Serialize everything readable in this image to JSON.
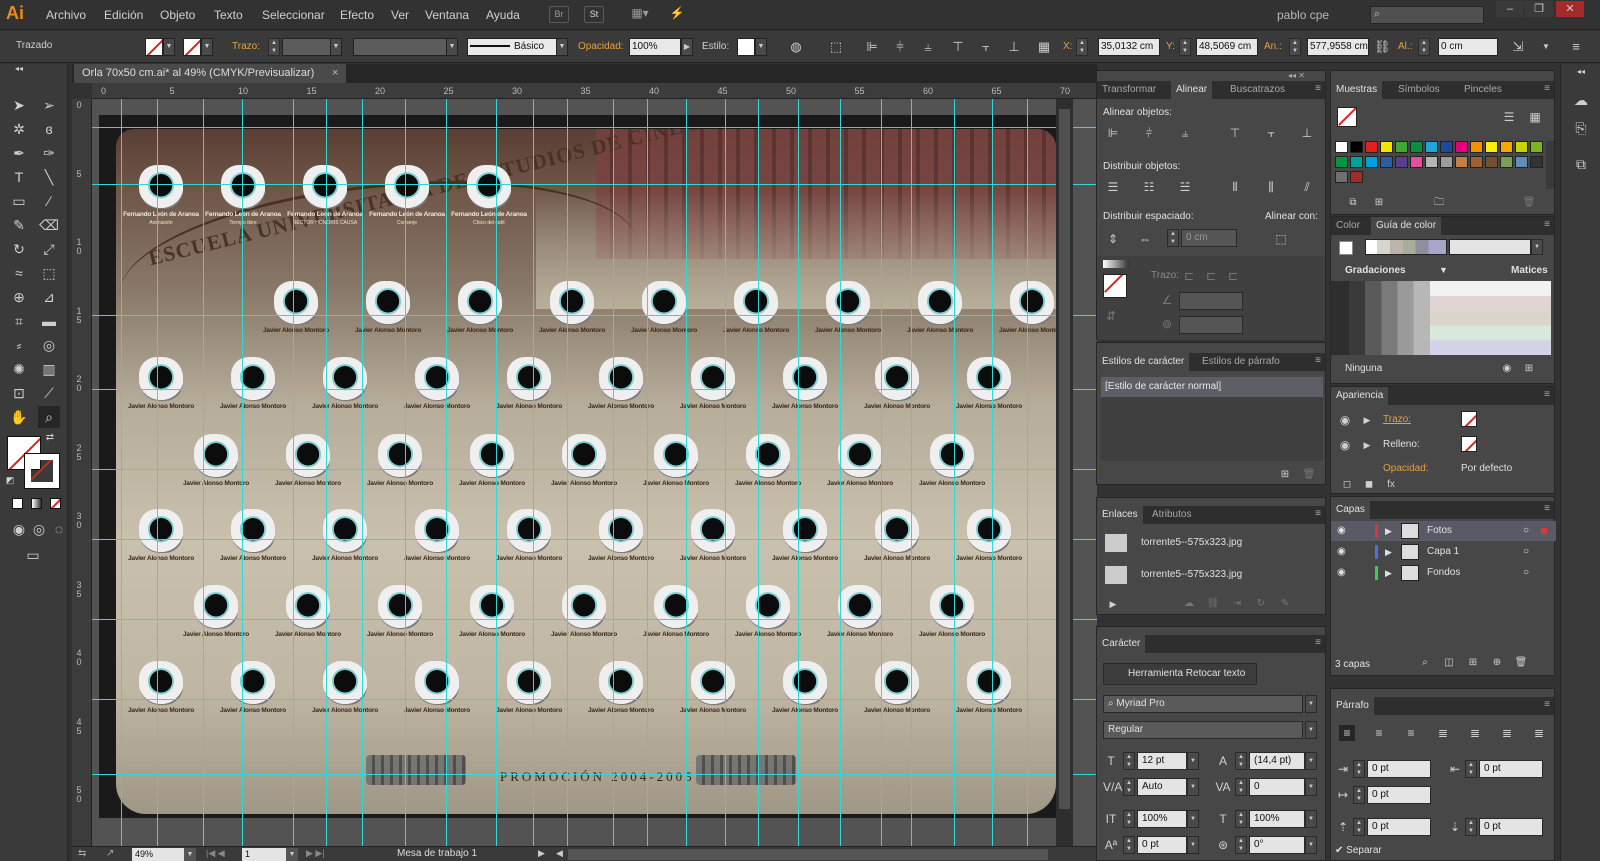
{
  "app": {
    "logo": "Ai",
    "menus": [
      "Archivo",
      "Edición",
      "Objeto",
      "Texto",
      "Seleccionar",
      "Efecto",
      "Ver",
      "Ventana",
      "Ayuda"
    ],
    "bridge_buttons": [
      "Br",
      "St"
    ],
    "user": "pablo cpe",
    "search_placeholder": ""
  },
  "control_bar": {
    "selection": "Trazado",
    "stroke_label": "Trazo:",
    "brush_label": "Básico",
    "opacity_label": "Opacidad:",
    "opacity_value": "100%",
    "style_label": "Estilo:",
    "x_label": "X:",
    "x_value": "35,0132 cm",
    "y_label": "Y:",
    "y_value": "48,5069 cm",
    "w_label": "An.:",
    "w_value": "577,9558 cm",
    "h_label": "Al.:",
    "h_value": "0 cm"
  },
  "document": {
    "tab_title": "Orla 70x50 cm.ai* al 49% (CMYK/Previsualizar)",
    "close": "×",
    "ruler_top": [
      "0",
      "5",
      "10",
      "15",
      "20",
      "25",
      "30",
      "35",
      "40",
      "45",
      "50",
      "55",
      "60",
      "65",
      "70"
    ],
    "ruler_left": [
      "0",
      "5",
      "1 0",
      "1 5",
      "2 0",
      "2 5",
      "3 0",
      "3 5",
      "4 0",
      "4 5",
      "5 0"
    ],
    "school_title": "ESCUELA UNIVERSITARIA DE ESTUDIOS DE CINE DE VALLADOLID",
    "teachers": [
      {
        "name": "Fernando León de Aranoa",
        "role": "Animación"
      },
      {
        "name": "Fernando León de Aranoa",
        "role": "Tiempo libre"
      },
      {
        "name": "Fernando León de Aranoa",
        "role": "RECTOR HONORIS CAUSA"
      },
      {
        "name": "Fernando León de Aranoa",
        "role": "Conserje"
      },
      {
        "name": "Fernando León de Aranoa",
        "role": "Chico del café"
      }
    ],
    "student_name": "Javier Alonso Montoro",
    "promotion": "PROMOCIÓN 2004-2005"
  },
  "status_bar": {
    "zoom": "49%",
    "page": "1",
    "artboard": "Mesa de trabajo 1"
  },
  "align_panel": {
    "tabs": [
      "Transformar",
      "Alinear",
      "Buscatrazos"
    ],
    "active": "Alinear",
    "align_objects": "Alinear objetos:",
    "distribute_objects": "Distribuir objetos:",
    "distribute_spacing": "Distribuir espaciado:",
    "align_to": "Alinear con:",
    "spacing_value": "0 cm",
    "stroke_label": "Trazo:"
  },
  "char_styles_panel": {
    "tabs": [
      "Estilos de carácter",
      "Estilos de párrafo"
    ],
    "items": [
      "[Estilo de carácter normal]"
    ]
  },
  "links_panel": {
    "tabs": [
      "Enlaces",
      "Atributos"
    ],
    "items": [
      "torrente5--575x323.jpg",
      "torrente5--575x323.jpg"
    ]
  },
  "character_panel": {
    "title": "Carácter",
    "touch_tool": "Herramienta Retocar texto",
    "font": "Myriad Pro",
    "style": "Regular",
    "size": "12 pt",
    "leading": "(14,4 pt)",
    "kerning": "Auto",
    "tracking": "0",
    "vscale": "100%",
    "hscale": "100%",
    "baseline": "0 pt",
    "rotation": "0°"
  },
  "swatches_panel": {
    "tabs": [
      "Muestras",
      "Símbolos",
      "Pinceles"
    ],
    "colors": [
      "#ffffff",
      "#000000",
      "#e3201b",
      "#f4e500",
      "#41a833",
      "#0a8f3c",
      "#1ea6d8",
      "#1d4b9b",
      "#e6007e",
      "#f39200",
      "#fcea10",
      "#f7a600",
      "#c8d400",
      "#7ab51d",
      "#00963f",
      "#00a19a",
      "#009fe3",
      "#2b5ca6",
      "#5b3e8d",
      "#e84e9a",
      "#b5b5b5",
      "#9d9d9c",
      "#c77e40",
      "#a06030",
      "#705030",
      "#7a9e5a",
      "#5f8fb4",
      "#333333",
      "#6f6f6e",
      "#9a2e2e"
    ]
  },
  "color_guide_panel": {
    "tabs": [
      "Color",
      "Guía de color"
    ],
    "gradations": "Gradaciones",
    "matrices": "Matices",
    "none_label": "Ninguna"
  },
  "appearance_panel": {
    "title": "Apariencia",
    "rows": [
      {
        "label": "Trazo:"
      },
      {
        "label": "Relleno:"
      },
      {
        "label": "Opacidad:",
        "value": "Por defecto"
      }
    ]
  },
  "layers_panel": {
    "title": "Capas",
    "layers": [
      "Fotos",
      "Capa 1",
      "Fondos"
    ],
    "layer_colors": [
      "#e0343a",
      "#4f6ee8",
      "#44c85a"
    ],
    "count": "3 capas"
  },
  "paragraph_panel": {
    "title": "Párrafo",
    "left_indent": "0 pt",
    "right_indent": "0 pt",
    "first_indent": "0 pt",
    "space_before": "0 pt",
    "space_after": "0 pt",
    "hyphenate": "Separar"
  }
}
